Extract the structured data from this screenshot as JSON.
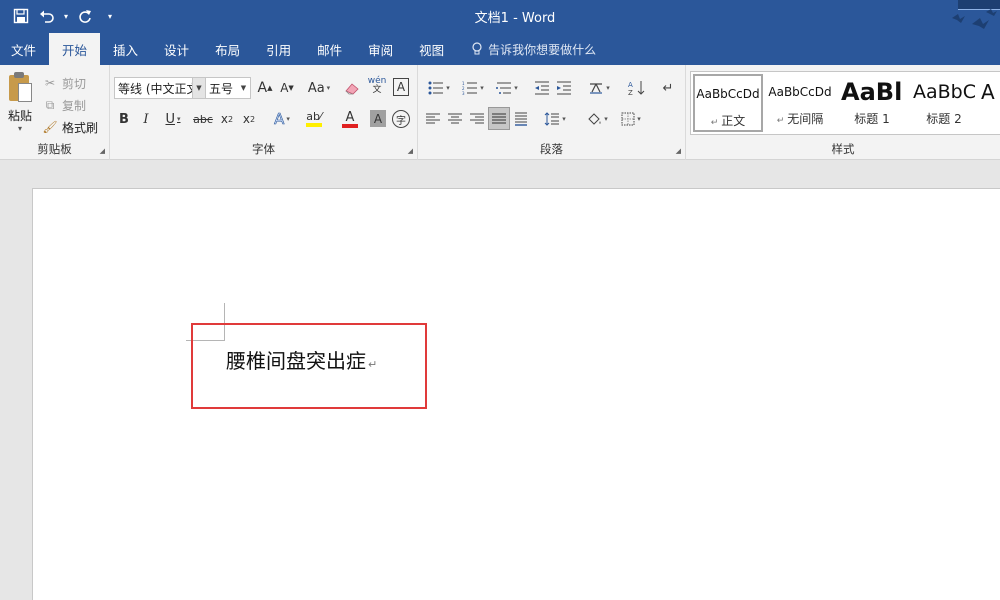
{
  "window": {
    "title": "文档1  -  Word"
  },
  "quick_access": {
    "save_icon": "save-icon",
    "undo_icon": "undo-icon",
    "redo_icon": "redo-icon",
    "customize_icon": "customize-icon"
  },
  "tabs": [
    {
      "label": "文件"
    },
    {
      "label": "开始",
      "active": true
    },
    {
      "label": "插入"
    },
    {
      "label": "设计"
    },
    {
      "label": "布局"
    },
    {
      "label": "引用"
    },
    {
      "label": "邮件"
    },
    {
      "label": "审阅"
    },
    {
      "label": "视图"
    }
  ],
  "tell_me": {
    "label": "告诉我你想要做什么"
  },
  "clipboard": {
    "group_label": "剪贴板",
    "paste_label": "粘贴",
    "cut_label": "剪切",
    "copy_label": "复制",
    "format_painter_label": "格式刷"
  },
  "font": {
    "group_label": "字体",
    "font_name": "等线 (中文正文)",
    "font_size": "五号",
    "change_case": "Aa",
    "phonetic": "wén",
    "phonetic_sub": "文"
  },
  "paragraph": {
    "group_label": "段落"
  },
  "styles": {
    "group_label": "样式",
    "items": [
      {
        "sample": "AaBbCcDd",
        "name": "正文"
      },
      {
        "sample": "AaBbCcDd",
        "name": "无间隔"
      },
      {
        "sample": "AaBl",
        "name": "标题 1"
      },
      {
        "sample": "AaBbC",
        "name": "标题 2"
      },
      {
        "sample": "A",
        "name": ""
      }
    ]
  },
  "document": {
    "text": "腰椎间盘突出症",
    "paragraph_mark": "↵"
  },
  "colors": {
    "title_bar": "#2b579a",
    "ribbon": "#f3f3f3",
    "highlight_border": "#e03a3a",
    "font_color_bar": "#e02020",
    "highlight_color_bar": "#ffef00"
  }
}
